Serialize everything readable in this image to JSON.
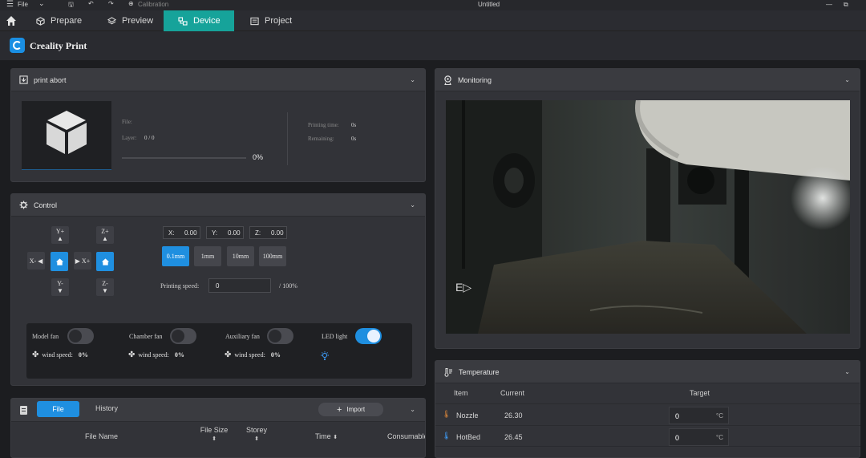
{
  "titlebar": {
    "file": "File",
    "calibration": "Calibration",
    "title": "Untitled"
  },
  "tabs": [
    {
      "label": "Prepare"
    },
    {
      "label": "Preview"
    },
    {
      "label": "Device"
    },
    {
      "label": "Project"
    }
  ],
  "brand": {
    "name": "Creality Print"
  },
  "job": {
    "title": "print abort",
    "file_label": "File:",
    "layer_label": "Layer:",
    "layer_value": "0 / 0",
    "progress_text": "0%",
    "progress": 0,
    "printing_time_label": "Printing time:",
    "printing_time_value": "0s",
    "remaining_label": "Remaining:",
    "remaining_value": "0s"
  },
  "control": {
    "title": "Control",
    "jog": {
      "y_plus": "Y+",
      "y_minus": "Y-",
      "x_minus": "X-",
      "x_plus": "X+",
      "z_plus": "Z+",
      "z_minus": "Z-"
    },
    "coords": {
      "x_label": "X:",
      "x_value": "0.00",
      "y_label": "Y:",
      "y_value": "0.00",
      "z_label": "Z:",
      "z_value": "0.00"
    },
    "steps": [
      "0.1mm",
      "1mm",
      "10mm",
      "100mm"
    ],
    "printing_speed_label": "Printing speed:",
    "printing_speed_value": "0",
    "printing_speed_max": "/ 100%",
    "fans": [
      {
        "label": "Model fan",
        "wind_label": "wind speed:",
        "wind_value": "0%",
        "on": false
      },
      {
        "label": "Chamber fan",
        "wind_label": "wind speed:",
        "wind_value": "0%",
        "on": false
      },
      {
        "label": "Auxiliary fan",
        "wind_label": "wind speed:",
        "wind_value": "0%",
        "on": false
      }
    ],
    "led": {
      "label": "LED light",
      "on": true
    }
  },
  "files": {
    "tab_file": "File",
    "tab_history": "History",
    "import_label": "Import",
    "columns": [
      "File Name",
      "File Size",
      "Storey",
      "Time",
      "Consumable"
    ]
  },
  "monitoring": {
    "title": "Monitoring"
  },
  "temperature": {
    "title": "Temperature",
    "columns": {
      "item": "Item",
      "current": "Current",
      "target": "Target"
    },
    "rows": [
      {
        "item": "Nozzle",
        "current": "26.30",
        "target": "0",
        "unit": "°C"
      },
      {
        "item": "HotBed",
        "current": "26.45",
        "target": "0",
        "unit": "°C"
      }
    ]
  },
  "colors": {
    "accent": "#1f8fe0",
    "device_tab": "#16a39a"
  }
}
